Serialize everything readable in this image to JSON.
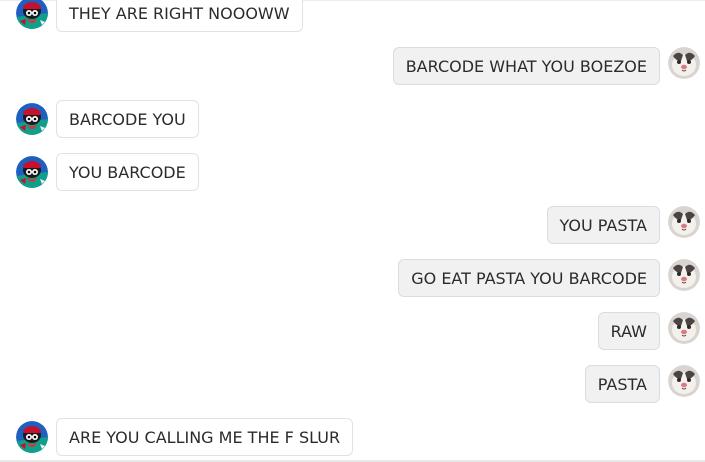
{
  "messages": [
    {
      "side": "incoming",
      "text": "THEY ARE RIGHT NOOOWW",
      "avatar": "pirate-bird-avatar"
    },
    {
      "side": "outgoing",
      "text": "BARCODE WHAT YOU BOEZOE",
      "avatar": "cat-avatar"
    },
    {
      "side": "incoming",
      "text": "BARCODE YOU",
      "avatar": "pirate-bird-avatar"
    },
    {
      "side": "incoming",
      "text": "YOU BARCODE",
      "avatar": "pirate-bird-avatar"
    },
    {
      "side": "outgoing",
      "text": "YOU PASTA",
      "avatar": "cat-avatar"
    },
    {
      "side": "outgoing",
      "text": "GO EAT PASTA YOU BARCODE",
      "avatar": "cat-avatar"
    },
    {
      "side": "outgoing",
      "text": "RAW",
      "avatar": "cat-avatar"
    },
    {
      "side": "outgoing",
      "text": "PASTA",
      "avatar": "cat-avatar"
    },
    {
      "side": "incoming",
      "text": "ARE YOU CALLING ME THE F SLUR",
      "avatar": "pirate-bird-avatar"
    }
  ],
  "colors": {
    "incoming_bubble": "#ffffff",
    "outgoing_bubble": "#f1f1f1",
    "text": "#2b2b2b"
  }
}
